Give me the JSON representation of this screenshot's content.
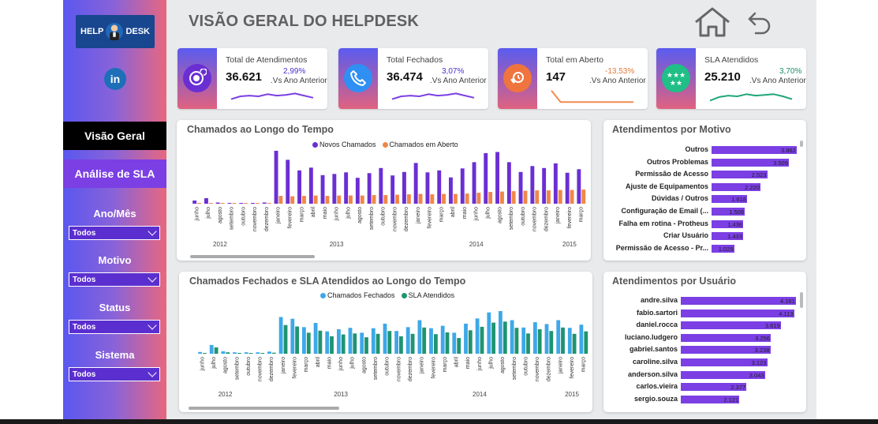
{
  "header": {
    "title": "VISÃO GERAL DO HELPDESK",
    "home_icon": "home-icon",
    "back_icon": "undo-arrow-icon"
  },
  "sidebar": {
    "logo_left": "HELP",
    "logo_right": "DESK",
    "linkedin": "in",
    "nav": [
      {
        "label": "Visão Geral"
      },
      {
        "label": "Análise de SLA"
      }
    ],
    "filters": [
      {
        "label": "Ano/Mês",
        "value": "Todos"
      },
      {
        "label": "Motivo",
        "value": "Todos"
      },
      {
        "label": "Status",
        "value": "Todos"
      },
      {
        "label": "Sistema",
        "value": "Todos"
      }
    ]
  },
  "kpis": [
    {
      "title": "Total de Atendimentos",
      "value": "36.621",
      "pct": "2,99%",
      "vs": ".Vs Ano Anterior",
      "pct_color": "#4a2fd0",
      "icon": "chat-icon",
      "band": [
        "#5a5bef",
        "#e0627f"
      ],
      "circle": "#6a2fd3",
      "spark_color": "#7b3fe4",
      "spark": [
        0.7,
        0.5,
        0.45,
        0.5,
        0.35,
        0.45,
        0.4,
        0.3,
        0.45,
        0.6
      ]
    },
    {
      "title": "Total Fechados",
      "value": "36.474",
      "pct": "3,07%",
      "vs": ".Vs Ano Anterior",
      "pct_color": "#4a2fd0",
      "icon": "phone-icon",
      "band": [
        "#5a5bef",
        "#e0627f"
      ],
      "circle": "#2f8ff3",
      "spark_color": "#7b3fe4",
      "spark": [
        0.7,
        0.5,
        0.45,
        0.5,
        0.35,
        0.45,
        0.4,
        0.3,
        0.45,
        0.6
      ]
    },
    {
      "title": "Total em Aberto",
      "value": "147",
      "pct": "-13,53%",
      "vs": ".Vs Ano Anterior",
      "pct_color": "#e07a3a",
      "icon": "clock-phone-icon",
      "band": [
        "#5a5bef",
        "#e0627f"
      ],
      "circle": "#f0743e",
      "spark_color": "#f08a50",
      "spark": [
        0.1,
        0.9,
        0.9,
        0.9,
        0.9,
        0.9,
        0.9,
        0.9,
        0.9,
        0.9
      ]
    },
    {
      "title": "SLA Atendidos",
      "value": "25.210",
      "pct": "3,70%",
      "vs": ".Vs Ano Anterior",
      "pct_color": "#1d8f63",
      "icon": "stars-icon",
      "band": [
        "#5a5bef",
        "#e0627f"
      ],
      "circle": "#1fbf86",
      "spark_color": "#1fa67a",
      "spark": [
        0.8,
        0.55,
        0.45,
        0.5,
        0.35,
        0.45,
        0.4,
        0.35,
        0.5,
        0.7
      ]
    }
  ],
  "chart1": {
    "title": "Chamados ao Longo do Tempo",
    "legend": [
      "Novos Chamados",
      "Chamados em Aberto"
    ],
    "colors": [
      "#6a2fd3",
      "#f0874a"
    ],
    "months": [
      "junho",
      "julho",
      "agosto",
      "setembro",
      "outubro",
      "novembro",
      "dezembro",
      "janeiro",
      "fevereiro",
      "março",
      "abril",
      "maio",
      "junho",
      "julho",
      "agosto",
      "setembro",
      "outubro",
      "novembro",
      "dezembro",
      "janeiro",
      "fevereiro",
      "março",
      "abril",
      "maio",
      "junho",
      "julho",
      "agosto",
      "setembro",
      "outubro",
      "novembro",
      "dezembro",
      "janeiro",
      "fevereiro",
      "março"
    ],
    "years": [
      {
        "label": "2012",
        "index": 2.5
      },
      {
        "label": "2013",
        "index": 12.5
      },
      {
        "label": "2014",
        "index": 24.5
      },
      {
        "label": "2015",
        "index": 32.5
      }
    ]
  },
  "chart2": {
    "title": "Chamados Fechados e SLA Atendidos ao Longo do Tempo",
    "legend": [
      "Chamados Fechados",
      "SLA Atendidos"
    ],
    "colors": [
      "#3ea8e8",
      "#1f9470"
    ]
  },
  "chart_data": [
    {
      "type": "bar",
      "title": "Chamados ao Longo do Tempo",
      "categories": [
        "junho 2012",
        "julho 2012",
        "agosto 2012",
        "setembro 2012",
        "outubro 2012",
        "novembro 2012",
        "dezembro 2012",
        "janeiro 2013",
        "fevereiro 2013",
        "março 2013",
        "abril 2013",
        "maio 2013",
        "junho 2013",
        "julho 2013",
        "agosto 2013",
        "setembro 2013",
        "outubro 2013",
        "novembro 2013",
        "dezembro 2013",
        "janeiro 2014",
        "fevereiro 2014",
        "março 2014",
        "abril 2014",
        "maio 2014",
        "junho 2014",
        "julho 2014",
        "agosto 2014",
        "setembro 2014",
        "outubro 2014",
        "novembro 2014",
        "dezembro 2014",
        "janeiro 2015",
        "fevereiro 2015",
        "março 2015"
      ],
      "series": [
        {
          "name": "Novos Chamados",
          "values": [
            80,
            140,
            30,
            20,
            20,
            20,
            30,
            1350,
            1120,
            850,
            920,
            730,
            760,
            800,
            660,
            780,
            910,
            720,
            810,
            1040,
            800,
            850,
            670,
            900,
            1060,
            1290,
            1320,
            1060,
            810,
            960,
            910,
            1030,
            790,
            880
          ]
        },
        {
          "name": "Chamados em Aberto",
          "values": [
            0,
            0,
            0,
            0,
            0,
            0,
            0,
            200,
            190,
            200,
            210,
            200,
            210,
            210,
            210,
            220,
            220,
            230,
            240,
            250,
            240,
            250,
            250,
            260,
            280,
            300,
            310,
            320,
            330,
            340,
            340,
            350,
            350,
            360
          ]
        }
      ],
      "legend": "top"
    },
    {
      "type": "bar",
      "title": "Chamados Fechados e SLA Atendidos ao Longo do Tempo",
      "categories": [
        "junho 2012",
        "julho 2012",
        "agosto 2012",
        "setembro 2012",
        "outubro 2012",
        "novembro 2012",
        "dezembro 2012",
        "janeiro 2013",
        "fevereiro 2013",
        "março 2013",
        "abril 2013",
        "maio 2013",
        "junho 2013",
        "julho 2013",
        "agosto 2013",
        "setembro 2013",
        "outubro 2013",
        "novembro 2013",
        "dezembro 2013",
        "janeiro 2014",
        "fevereiro 2014",
        "março 2014",
        "abril 2014",
        "maio 2014",
        "junho 2014",
        "julho 2014",
        "agosto 2014",
        "setembro 2014",
        "outubro 2014",
        "novembro 2014",
        "dezembro 2014",
        "janeiro 2015",
        "fevereiro 2015",
        "março 2015"
      ],
      "series": [
        {
          "name": "Chamados Fechados",
          "values": [
            50,
            250,
            70,
            40,
            40,
            40,
            60,
            1050,
            1000,
            760,
            880,
            640,
            700,
            740,
            600,
            730,
            860,
            650,
            760,
            960,
            730,
            800,
            600,
            860,
            1010,
            1180,
            1220,
            960,
            750,
            900,
            850,
            960,
            740,
            830
          ]
        },
        {
          "name": "SLA Atendidos",
          "values": [
            20,
            180,
            40,
            20,
            20,
            20,
            30,
            820,
            780,
            600,
            660,
            500,
            550,
            580,
            470,
            570,
            650,
            500,
            570,
            750,
            560,
            610,
            450,
            670,
            770,
            890,
            920,
            740,
            580,
            700,
            650,
            750,
            570,
            640
          ]
        }
      ],
      "legend": "top"
    },
    {
      "type": "bar",
      "title": "Atendimentos por Motivo",
      "categories": [
        "Outros",
        "Outros Problemas",
        "Permissão de Acesso",
        "Ajuste de Equipamentos",
        "Dúvidas / Outros",
        "Configuração de Email (...",
        "Falha em rotina - Protheus",
        "Criar Usuário",
        "Permissão de Acesso - Pr..."
      ],
      "values": [
        3862,
        3509,
        2523,
        2220,
        1618,
        1508,
        1438,
        1433,
        1029
      ],
      "labels": [
        "3.862",
        "3.509",
        "2.523",
        "2.220",
        "1.618",
        "1.508",
        "1.438",
        "1.433",
        "1.029"
      ]
    },
    {
      "type": "bar",
      "title": "Atendimentos por Usuário",
      "categories": [
        "andre.silva",
        "fabio.sartori",
        "daniel.rocca",
        "luciano.ludgero",
        "gabriel.santos",
        "caroline.silva",
        "anderson.silva",
        "carlos.vieira",
        "sergio.souza"
      ],
      "values": [
        4161,
        4113,
        3619,
        3256,
        3238,
        3123,
        3043,
        2377,
        2121
      ],
      "labels": [
        "4.161",
        "4.113",
        "3.619",
        "3.256",
        "3.238",
        "3.123",
        "3.043",
        "2.377",
        "2.121"
      ]
    }
  ]
}
